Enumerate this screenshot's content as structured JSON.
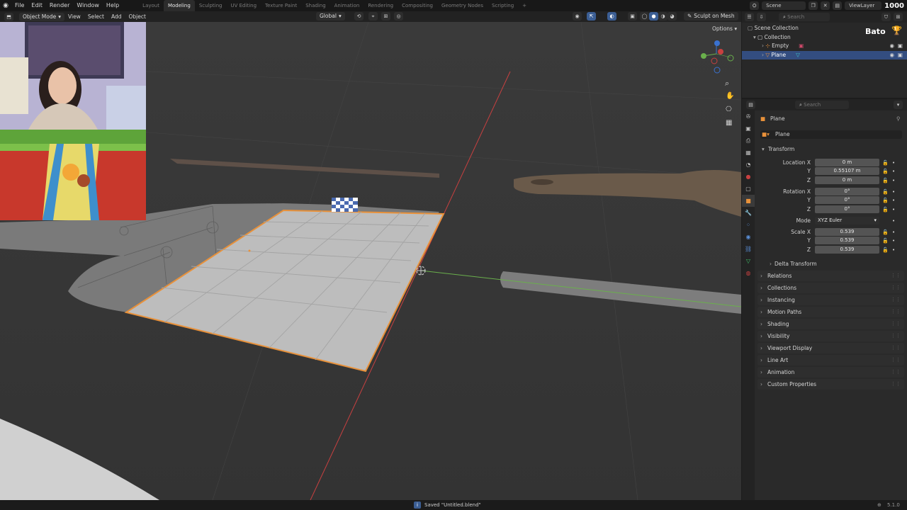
{
  "menu": [
    "File",
    "Edit",
    "Render",
    "Window",
    "Help"
  ],
  "workspaces": [
    "Layout",
    "Modeling",
    "Sculpting",
    "UV Editing",
    "Texture Paint",
    "Shading",
    "Animation",
    "Rendering",
    "Compositing",
    "Geometry Nodes",
    "Scripting"
  ],
  "active_workspace": "Modeling",
  "workspace_add": "+",
  "scene": "Scene",
  "view_layer": "ViewLayer",
  "overlay_counter": "1000",
  "viewport_header": {
    "mode": "Object Mode",
    "menus": [
      "View",
      "Select",
      "Add",
      "Object"
    ],
    "orientation": "Global",
    "sculpt_button": "Sculpt on Mesh",
    "options": "Options"
  },
  "outliner": {
    "search_placeholder": "Search",
    "scene_collection": "Scene Collection",
    "collection": "Collection",
    "items": [
      "Empty",
      "Plane"
    ],
    "selected": "Plane",
    "badge_text": "Bato"
  },
  "properties": {
    "search_placeholder": "Search",
    "object_name": "Plane",
    "datablock_name": "Plane",
    "transform_label": "Transform",
    "location": {
      "label_x": "Location X",
      "label_y": "Y",
      "label_z": "Z",
      "x": "0 m",
      "y": "0.55107 m",
      "z": "0 m"
    },
    "rotation": {
      "label_x": "Rotation X",
      "label_y": "Y",
      "label_z": "Z",
      "x": "0°",
      "y": "0°",
      "z": "0°"
    },
    "mode_label": "Mode",
    "mode_value": "XYZ Euler",
    "scale": {
      "label_x": "Scale X",
      "label_y": "Y",
      "label_z": "Z",
      "x": "0.539",
      "y": "0.539",
      "z": "0.539"
    },
    "delta_transform": "Delta Transform",
    "panels": [
      "Relations",
      "Collections",
      "Instancing",
      "Motion Paths",
      "Shading",
      "Visibility",
      "Viewport Display",
      "Line Art",
      "Animation",
      "Custom Properties"
    ]
  },
  "status": {
    "message": "Saved \"Untitled.blend\"",
    "version": "5.1.0"
  },
  "colors": {
    "selection_outline": "#e8913a",
    "x_axis": "#c84040",
    "y_axis": "#6ab04c",
    "selected_row": "#334d80",
    "active_tab": "#2c2c2c"
  }
}
